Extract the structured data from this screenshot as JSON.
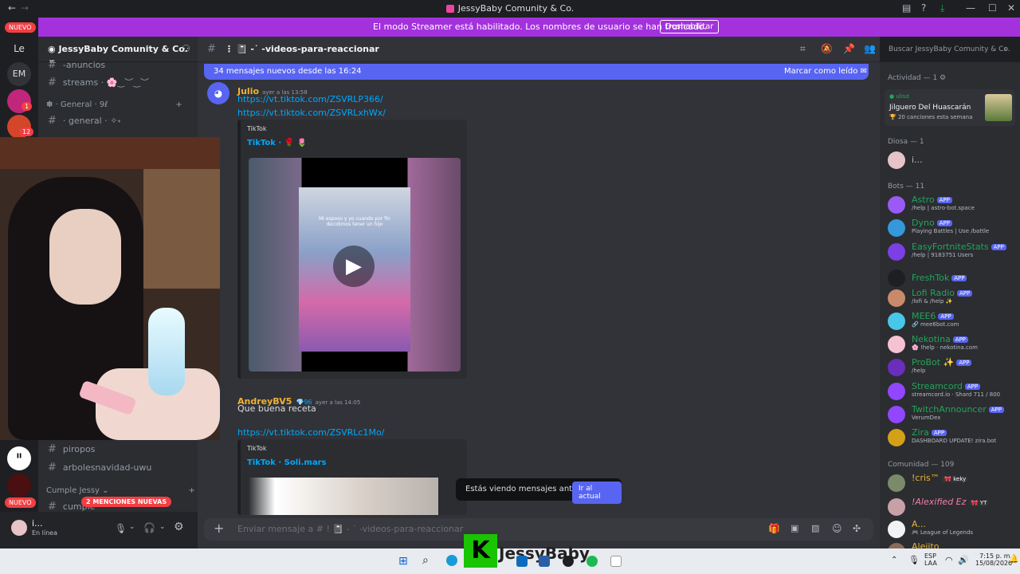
{
  "window": {
    "title": "JessyBaby Comunity & Co."
  },
  "streamer_bar": {
    "message": "El modo Streamer está habilitado. Los nombres de usuario se han truncado.",
    "button": "Deshabilitar"
  },
  "rail": {
    "nuevo_top": "NUEVO",
    "le": "Le",
    "em": "EM",
    "badge1": "1",
    "badge2": "12",
    "nuevo_bottom": "NUEVO"
  },
  "server": {
    "name": "JessyBaby Comunity & Co."
  },
  "channels": {
    "anuncios": "-anuncios",
    "streams": "streams · 🌸‿︶‿︶",
    "cat_general": "✽ · General · 9ℓ",
    "general": "· general · ✧˖",
    "piropos": "piropos",
    "arboles": "arbolesnavidad-uwu",
    "cat_cumple": "Cumple Jessy",
    "cumple": "cumple",
    "mentions": "2 MENCIONES NUEVAS"
  },
  "user": {
    "name": "i...",
    "status": "En línea"
  },
  "chat": {
    "channel": "-videos-para-reaccionar",
    "new_messages": "34 mensajes nuevos desde las 16:24",
    "mark_read": "Marcar como leído",
    "search_placeholder": "Buscar JessyBaby Comunity & Co."
  },
  "messages": [
    {
      "author": "Julio",
      "time": "ayer a las 13:58",
      "links": [
        "https://vt.tiktok.com/ZSVRLP366/",
        "https://vt.tiktok.com/ZSVRLxhWx/"
      ],
      "embed_provider": "TikTok",
      "embed_title": "TikTok · 🌹 🌷",
      "video_caption": "Mi esposo y yo cuando por fin decidimos tener un hijo"
    },
    {
      "author": "AndreyBV5",
      "badge": "96",
      "time": "ayer a las 14:05",
      "text": "Que buena receta",
      "link": "https://vt.tiktok.com/ZSVRLc1Mo/",
      "embed_provider": "TikTok",
      "embed_title": "TikTok · Soli.mars"
    }
  ],
  "composer": {
    "placeholder": "Enviar mensaje a # ! 📓 - ˙ -videos-para-reaccionar"
  },
  "toast": {
    "text": "Estás viendo mensajes antiguos",
    "button": "Ir al actual"
  },
  "members": {
    "activity_header": "Actividad — 1 ⚙",
    "activity": {
      "tag": "ulisd",
      "title": "Jilguero Del Huascarán",
      "sub": "20 canciones esta semana"
    },
    "diosa_header": "Diosa — 1",
    "diosa": [
      {
        "name": "i..."
      }
    ],
    "bots_header": "Bots — 11",
    "app_label": "APP",
    "bots": [
      {
        "name": "Astro",
        "status": "/help | astro-bot.space",
        "color": "#9b59f6"
      },
      {
        "name": "Dyno",
        "status": "Playing Battles | Use /battle",
        "color": "#3498db"
      },
      {
        "name": "EasyFortniteStats",
        "status": "/help | 9183751 Users",
        "color": "#7b3fe4"
      },
      {
        "name": "FreshTok",
        "status": "",
        "color": "#1e1f22"
      },
      {
        "name": "Lofi Radio",
        "status": "/lofi & /help ✨",
        "color": "#c98a6b"
      },
      {
        "name": "MEE6",
        "status": "🔗 mee6bot.com",
        "color": "#49c7e8"
      },
      {
        "name": "Nekotina",
        "status": "🌸 !help · nekotina.com",
        "color": "#f5c2d4"
      },
      {
        "name": "ProBot ✨",
        "status": "/help",
        "color": "#6a2dbd"
      },
      {
        "name": "Streamcord",
        "status": "streamcord.io · Shard 711 / 800",
        "color": "#9146ff"
      },
      {
        "name": "TwitchAnnouncer",
        "status": "VerumDex",
        "color": "#9146ff"
      },
      {
        "name": "Zira",
        "status": "DASHBOARD UPDATE! zira.bot",
        "color": "#d4a017"
      }
    ],
    "community_header": "Comunidad — 109",
    "community": [
      {
        "name": "!cris™",
        "tag": "🎀 keky"
      },
      {
        "name": "!Alexified Ez",
        "tag": "🎀 YT"
      },
      {
        "name": "A...",
        "status": "🎮 League of Legends"
      },
      {
        "name": "Alejito"
      }
    ]
  },
  "overlay": {
    "brand": "JessyBaby"
  },
  "taskbar": {
    "lang": "ESP",
    "lang2": "LAA",
    "time": "7:15 p. m.",
    "date": "15/08/2026"
  }
}
